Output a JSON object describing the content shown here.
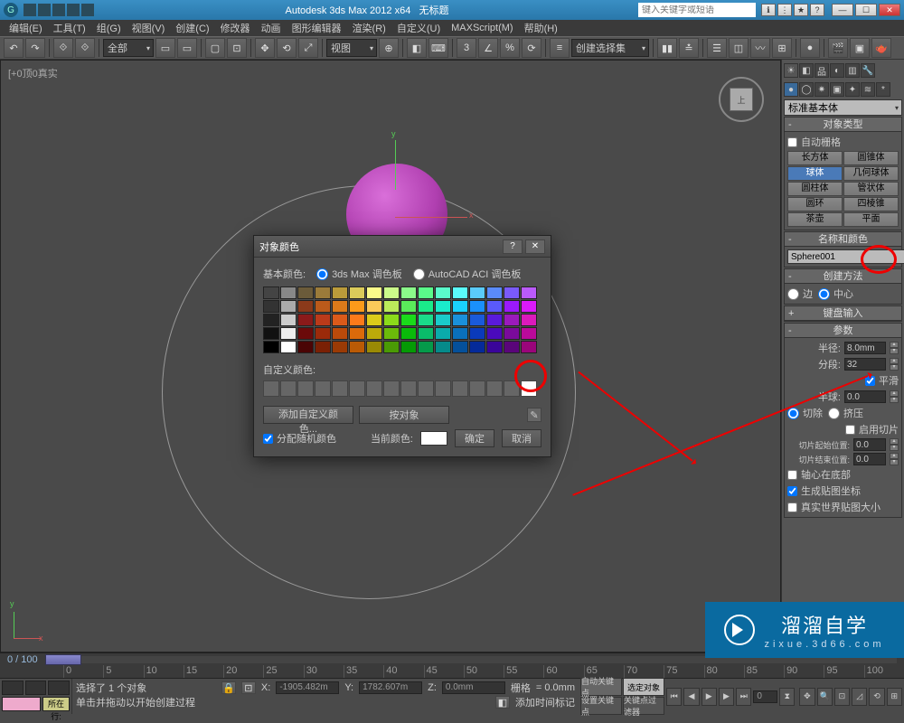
{
  "title": {
    "app": "Autodesk 3ds Max 2012 x64",
    "doc": "无标题"
  },
  "search_placeholder": "键入关键字或短语",
  "menu": {
    "edit": "编辑(E)",
    "tools": "工具(T)",
    "group": "组(G)",
    "views": "视图(V)",
    "create": "创建(C)",
    "modifiers": "修改器",
    "animation": "动画",
    "grapheditors": "图形编辑器",
    "rendering": "渲染(R)",
    "customize": "自定义(U)",
    "maxscript": "MAXScript(M)",
    "help": "帮助(H)"
  },
  "toolbar": {
    "all": "全部",
    "view": "视图",
    "selset": "创建选择集"
  },
  "viewport": {
    "label": "[+0顶0真实",
    "cube_face": "上",
    "axis_y": "y",
    "axis_x": "x"
  },
  "panel": {
    "category": "标准基本体",
    "obj_type_title": "对象类型",
    "autogrid": "自动栅格",
    "buttons": {
      "box": "长方体",
      "cone": "圆锥体",
      "sphere": "球体",
      "geosphere": "几何球体",
      "cylinder": "圆柱体",
      "tube": "管状体",
      "torus": "圆环",
      "pyramid": "四棱锥",
      "teapot": "茶壶",
      "plane": "平面"
    },
    "name_color_title": "名称和颜色",
    "object_name": "Sphere001",
    "create_method_title": "创建方法",
    "edge": "边",
    "center": "中心",
    "keyboard_title": "键盘输入",
    "params_title": "参数",
    "radius_lbl": "半径:",
    "radius_val": "8.0mm",
    "segs_lbl": "分段:",
    "segs_val": "32",
    "smooth": "平滑",
    "hemi_lbl": "半球:",
    "hemi_val": "0.0",
    "chop": "切除",
    "squash": "挤压",
    "sliceon": "启用切片",
    "slicefrom_lbl": "切片起始位置:",
    "slicefrom_val": "0.0",
    "sliceto_lbl": "切片结束位置:",
    "sliceto_val": "0.0",
    "basepivot": "轴心在底部",
    "genmapcoords": "生成贴图坐标",
    "realworld": "真实世界贴图大小"
  },
  "dialog": {
    "title": "对象颜色",
    "basic_colors": "基本颜色:",
    "pal_3dsmax": "3ds Max 调色板",
    "pal_autocad": "AutoCAD ACI 调色板",
    "custom_colors": "自定义颜色:",
    "add_custom": "添加自定义颜色...",
    "by_object": "按对象",
    "assign_random": "分配随机颜色",
    "current_color": "当前颜色:",
    "ok": "确定",
    "cancel": "取消",
    "palette": [
      [
        "#444",
        "#888",
        "#6b5b3a",
        "#9b7b3a",
        "#bb9b3a",
        "#dbcb5a",
        "#fbfb8a",
        "#cbfb8a",
        "#8bfb8a",
        "#5afb8a",
        "#5afbcb",
        "#5afbfb",
        "#5acbfb",
        "#5a8bfb",
        "#7a5afb",
        "#ba5afb"
      ],
      [
        "#333",
        "#aaa",
        "#8b3a1a",
        "#bb5a1a",
        "#db7a1a",
        "#fb9a1a",
        "#fbcb5a",
        "#bbeb5a",
        "#5aeb5a",
        "#1aeb8a",
        "#1aebcb",
        "#1ad0fb",
        "#1a90fb",
        "#5a5afb",
        "#9a1afb",
        "#db1afb"
      ],
      [
        "#222",
        "#ccc",
        "#8b1a1a",
        "#bb3a1a",
        "#db5a1a",
        "#fb7a1a",
        "#dbcb1a",
        "#8bdb1a",
        "#1adb1a",
        "#1adb8a",
        "#1acbcb",
        "#1a90db",
        "#1a5adb",
        "#5a1adb",
        "#9a1abb",
        "#db1abb"
      ],
      [
        "#111",
        "#eee",
        "#6b0a0a",
        "#9b2a0a",
        "#bb4a0a",
        "#db6a0a",
        "#bbaa0a",
        "#6bbb0a",
        "#0abb0a",
        "#0abb6a",
        "#0aabab",
        "#0a70bb",
        "#0a3abb",
        "#4a0abb",
        "#7a0a9b",
        "#bb0a9b"
      ],
      [
        "#000",
        "#fff",
        "#4a0505",
        "#7a2005",
        "#9a3a05",
        "#ba5a05",
        "#9a8a05",
        "#4a9a05",
        "#059a05",
        "#059a4a",
        "#058a8a",
        "#05509a",
        "#052a9a",
        "#3a059a",
        "#5a057a",
        "#9a057a"
      ]
    ]
  },
  "timeline": {
    "range": "0 / 100",
    "ticks": [
      "0",
      "5",
      "10",
      "15",
      "20",
      "25",
      "30",
      "35",
      "40",
      "45",
      "50",
      "55",
      "60",
      "65",
      "70",
      "75",
      "80",
      "85",
      "90",
      "95",
      "100"
    ]
  },
  "status": {
    "selected": "选择了 1 个对象",
    "hint": "单击并拖动以开始创建过程",
    "x_lbl": "X:",
    "x_val": "-1905.482m",
    "y_lbl": "Y:",
    "y_val": "1782.607m",
    "z_lbl": "Z:",
    "z_val": "0.0mm",
    "grid_lbl": "栅格",
    "grid_val": "= 0.0mm",
    "addtime": "添加时间标记",
    "autokey": "自动关键点",
    "selkey": "选定对象",
    "setkey": "设置关键点",
    "keyfilter": "关键点过滤器",
    "locked": "所在行:"
  },
  "watermark": {
    "main": "溜溜自学",
    "sub": "zixue.3d66.com"
  }
}
